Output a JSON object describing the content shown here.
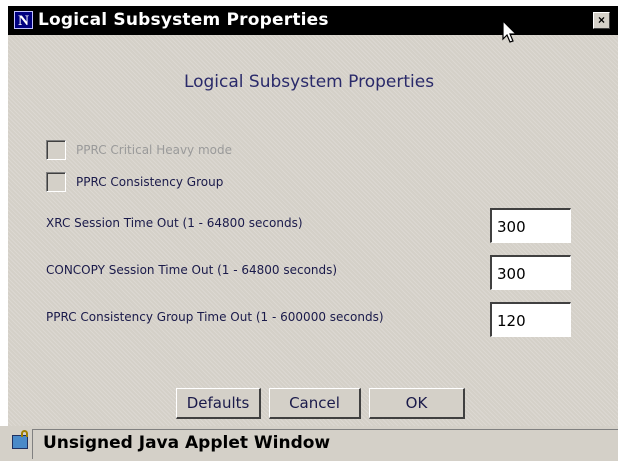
{
  "window": {
    "title": "Logical Subsystem Properties",
    "app_icon": "N",
    "close_glyph": "×"
  },
  "main": {
    "heading": "Logical Subsystem Properties",
    "checkboxes": [
      {
        "label": "PPRC Critical Heavy mode",
        "checked": false,
        "enabled": false
      },
      {
        "label": "PPRC Consistency Group",
        "checked": false,
        "enabled": true
      }
    ],
    "fields": [
      {
        "label": "XRC Session Time Out  (1 - 64800 seconds)",
        "value": "300"
      },
      {
        "label": "CONCOPY Session Time Out  (1 - 64800 seconds)",
        "value": "300"
      },
      {
        "label": "PPRC Consistency Group Time Out  (1 - 600000 seconds)",
        "value": "120"
      }
    ]
  },
  "buttons": {
    "defaults": "Defaults",
    "cancel": "Cancel",
    "ok": "OK"
  },
  "statusbar": {
    "text": "Unsigned Java Applet Window",
    "icon": "unlocked-padlock-icon"
  }
}
